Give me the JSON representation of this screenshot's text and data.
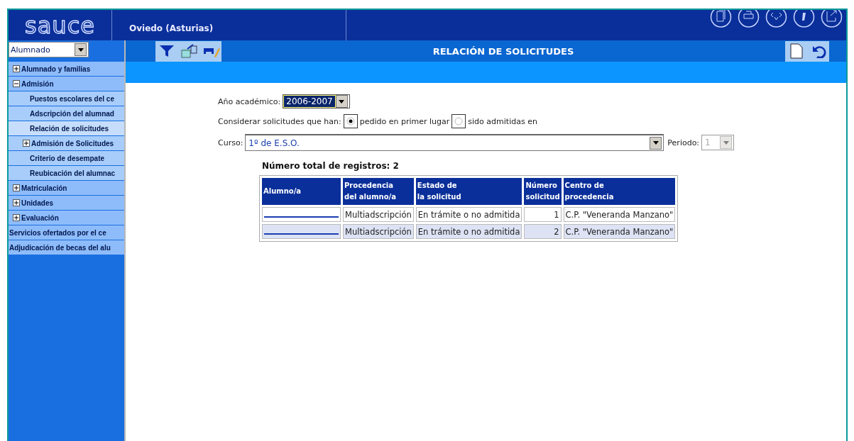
{
  "header": {
    "logo": "sauce",
    "location": "Oviedo (Asturias)"
  },
  "module_select": {
    "value": "Alumnado"
  },
  "sidebar": {
    "items": [
      {
        "label": "Alumnado y familias",
        "expanded": false,
        "selected": false
      },
      {
        "label": "Admisión",
        "expanded": true,
        "selected": false,
        "children": [
          {
            "label": "Puestos escolares del ce",
            "selected": false
          },
          {
            "label": "Adscripción del alumnad",
            "selected": false
          },
          {
            "label": "Relación de solicitudes",
            "selected": true
          },
          {
            "label": "Admisión de Solicitudes",
            "expanded": false,
            "selected": false
          },
          {
            "label": "Criterio de desempate",
            "selected": false
          },
          {
            "label": "Reubicación del alumnac",
            "selected": false
          }
        ]
      },
      {
        "label": "Matriculación",
        "expanded": false,
        "selected": false
      },
      {
        "label": "Unidades",
        "expanded": false,
        "selected": false
      },
      {
        "label": "Evaluación",
        "expanded": false,
        "selected": false
      },
      {
        "label": "Servicios ofertados por el ce",
        "kind": "link",
        "selected": false
      },
      {
        "label": "Adjudicación de becas del alu",
        "kind": "link",
        "selected": false
      }
    ]
  },
  "toolbar": {
    "title": "RELACIÓN DE SOLICITUDES"
  },
  "form": {
    "year_label": "Año académico:",
    "year_value": "2006-2007",
    "consider_label": "Considerar solicitudes que han:",
    "options": [
      {
        "label": "pedido en primer lugar",
        "selected": true
      },
      {
        "label": "sido admitidas en",
        "selected": false
      }
    ],
    "course_label": "Curso:",
    "course_value": "1º de E.S.O.",
    "period_label": "Periodo:",
    "period_value": "1",
    "period_disabled": true
  },
  "total": "Número total de registros: 2",
  "table": {
    "columns": [
      [
        "Alumno/a"
      ],
      [
        "Procedencia",
        "del alumno/a"
      ],
      [
        "Estado de",
        "la solicitud"
      ],
      [
        "Número",
        "solicitud"
      ],
      [
        "Centro de",
        "procedencia"
      ]
    ],
    "rows": [
      {
        "procedencia": "Multiadscripción",
        "estado": "En trámite o no admitida",
        "numero": "1",
        "centro": "C.P. \"Veneranda Manzano\""
      },
      {
        "procedencia": "Multiadscripción",
        "estado": "En trámite o no admitida",
        "numero": "2",
        "centro": "C.P. \"Veneranda Manzano\""
      }
    ]
  }
}
